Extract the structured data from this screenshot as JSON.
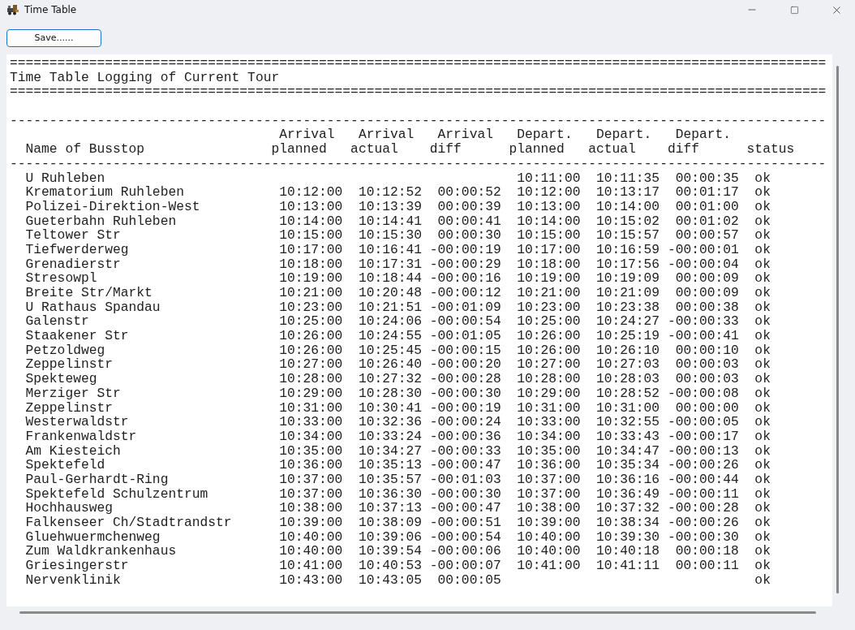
{
  "window": {
    "title": "Time Table"
  },
  "toolbar": {
    "save_button": "Save......"
  },
  "log": {
    "rule_top": "=======================================================================================================",
    "title": "Time Table Logging of Current Tour",
    "rule_title": "=======================================================================================================",
    "rule_header_top": "-------------------------------------------------------------------------------------------------------",
    "rule_header_bottom": "-------------------------------------------------------------------------------------------------------",
    "columns": [
      {
        "kind": "name",
        "bottom": "Name of Busstop"
      },
      {
        "kind": "time",
        "top": "Arrival",
        "bottom": "planned"
      },
      {
        "kind": "time",
        "top": "Arrival",
        "bottom": "actual"
      },
      {
        "kind": "diff",
        "top": "Arrival",
        "bottom": "diff"
      },
      {
        "kind": "time",
        "top": "Depart.",
        "bottom": "planned"
      },
      {
        "kind": "time",
        "top": "Depart.",
        "bottom": "actual"
      },
      {
        "kind": "diff",
        "top": "Depart.",
        "bottom": "diff"
      },
      {
        "kind": "status",
        "bottom": "status"
      }
    ],
    "rows": [
      [
        "U Ruhleben",
        null,
        null,
        null,
        "10:11:00",
        "10:11:35",
        "00:00:35",
        "ok"
      ],
      [
        "Krematorium Ruhleben",
        "10:12:00",
        "10:12:52",
        "00:00:52",
        "10:12:00",
        "10:13:17",
        "00:01:17",
        "ok"
      ],
      [
        "Polizei-Direktion-West",
        "10:13:00",
        "10:13:39",
        "00:00:39",
        "10:13:00",
        "10:14:00",
        "00:01:00",
        "ok"
      ],
      [
        "Gueterbahn Ruhleben",
        "10:14:00",
        "10:14:41",
        "00:00:41",
        "10:14:00",
        "10:15:02",
        "00:01:02",
        "ok"
      ],
      [
        "Teltower Str",
        "10:15:00",
        "10:15:30",
        "00:00:30",
        "10:15:00",
        "10:15:57",
        "00:00:57",
        "ok"
      ],
      [
        "Tiefwerderweg",
        "10:17:00",
        "10:16:41",
        "-00:00:19",
        "10:17:00",
        "10:16:59",
        "-00:00:01",
        "ok"
      ],
      [
        "Grenadierstr",
        "10:18:00",
        "10:17:31",
        "-00:00:29",
        "10:18:00",
        "10:17:56",
        "-00:00:04",
        "ok"
      ],
      [
        "Stresowpl",
        "10:19:00",
        "10:18:44",
        "-00:00:16",
        "10:19:00",
        "10:19:09",
        "00:00:09",
        "ok"
      ],
      [
        "Breite Str/Markt",
        "10:21:00",
        "10:20:48",
        "-00:00:12",
        "10:21:00",
        "10:21:09",
        "00:00:09",
        "ok"
      ],
      [
        "U Rathaus Spandau",
        "10:23:00",
        "10:21:51",
        "-00:01:09",
        "10:23:00",
        "10:23:38",
        "00:00:38",
        "ok"
      ],
      [
        "Galenstr",
        "10:25:00",
        "10:24:06",
        "-00:00:54",
        "10:25:00",
        "10:24:27",
        "-00:00:33",
        "ok"
      ],
      [
        "Staakener Str",
        "10:26:00",
        "10:24:55",
        "-00:01:05",
        "10:26:00",
        "10:25:19",
        "-00:00:41",
        "ok"
      ],
      [
        "Petzoldweg",
        "10:26:00",
        "10:25:45",
        "-00:00:15",
        "10:26:00",
        "10:26:10",
        "00:00:10",
        "ok"
      ],
      [
        "Zeppelinstr",
        "10:27:00",
        "10:26:40",
        "-00:00:20",
        "10:27:00",
        "10:27:03",
        "00:00:03",
        "ok"
      ],
      [
        "Spekteweg",
        "10:28:00",
        "10:27:32",
        "-00:00:28",
        "10:28:00",
        "10:28:03",
        "00:00:03",
        "ok"
      ],
      [
        "Merziger Str",
        "10:29:00",
        "10:28:30",
        "-00:00:30",
        "10:29:00",
        "10:28:52",
        "-00:00:08",
        "ok"
      ],
      [
        "Zeppelinstr",
        "10:31:00",
        "10:30:41",
        "-00:00:19",
        "10:31:00",
        "10:31:00",
        "00:00:00",
        "ok"
      ],
      [
        "Westerwaldstr",
        "10:33:00",
        "10:32:36",
        "-00:00:24",
        "10:33:00",
        "10:32:55",
        "-00:00:05",
        "ok"
      ],
      [
        "Frankenwaldstr",
        "10:34:00",
        "10:33:24",
        "-00:00:36",
        "10:34:00",
        "10:33:43",
        "-00:00:17",
        "ok"
      ],
      [
        "Am Kiesteich",
        "10:35:00",
        "10:34:27",
        "-00:00:33",
        "10:35:00",
        "10:34:47",
        "-00:00:13",
        "ok"
      ],
      [
        "Spektefeld",
        "10:36:00",
        "10:35:13",
        "-00:00:47",
        "10:36:00",
        "10:35:34",
        "-00:00:26",
        "ok"
      ],
      [
        "Paul-Gerhardt-Ring",
        "10:37:00",
        "10:35:57",
        "-00:01:03",
        "10:37:00",
        "10:36:16",
        "-00:00:44",
        "ok"
      ],
      [
        "Spektefeld Schulzentrum",
        "10:37:00",
        "10:36:30",
        "-00:00:30",
        "10:37:00",
        "10:36:49",
        "-00:00:11",
        "ok"
      ],
      [
        "Hochhausweg",
        "10:38:00",
        "10:37:13",
        "-00:00:47",
        "10:38:00",
        "10:37:32",
        "-00:00:28",
        "ok"
      ],
      [
        "Falkenseer Ch/Stadtrandstr",
        "10:39:00",
        "10:38:09",
        "-00:00:51",
        "10:39:00",
        "10:38:34",
        "-00:00:26",
        "ok"
      ],
      [
        "Gluehwuermchenweg",
        "10:40:00",
        "10:39:06",
        "-00:00:54",
        "10:40:00",
        "10:39:30",
        "-00:00:30",
        "ok"
      ],
      [
        "Zum Waldkrankenhaus",
        "10:40:00",
        "10:39:54",
        "-00:00:06",
        "10:40:00",
        "10:40:18",
        "00:00:18",
        "ok"
      ],
      [
        "Griesingerstr",
        "10:41:00",
        "10:40:53",
        "-00:00:07",
        "10:41:00",
        "10:41:11",
        "00:00:11",
        "ok"
      ],
      [
        "Nervenklinik",
        "10:43:00",
        "10:43:05",
        "00:00:05",
        null,
        null,
        null,
        "ok"
      ]
    ]
  }
}
